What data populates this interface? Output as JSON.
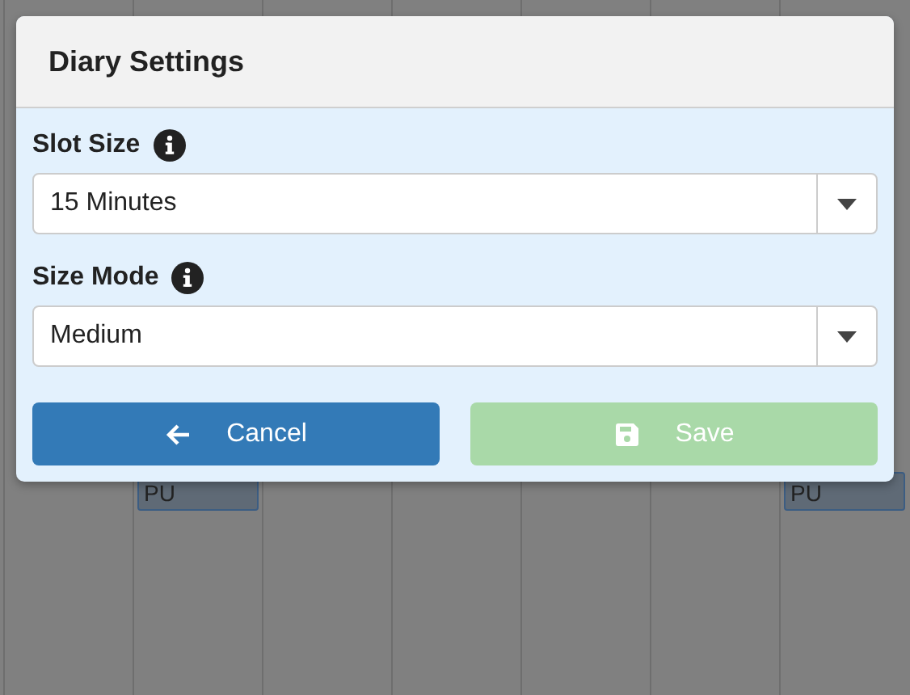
{
  "background": {
    "columns": [
      {},
      {
        "entry": "PU"
      },
      {},
      {},
      {},
      {},
      {
        "entry": "PU"
      }
    ]
  },
  "dialog": {
    "title": "Diary Settings",
    "fields": [
      {
        "label": "Slot Size",
        "value": "15 Minutes"
      },
      {
        "label": "Size Mode",
        "value": "Medium"
      }
    ],
    "buttons": [
      {
        "label": "Cancel",
        "kind": "back",
        "disabled": false
      },
      {
        "label": "Save",
        "kind": "save",
        "disabled": true
      }
    ]
  }
}
